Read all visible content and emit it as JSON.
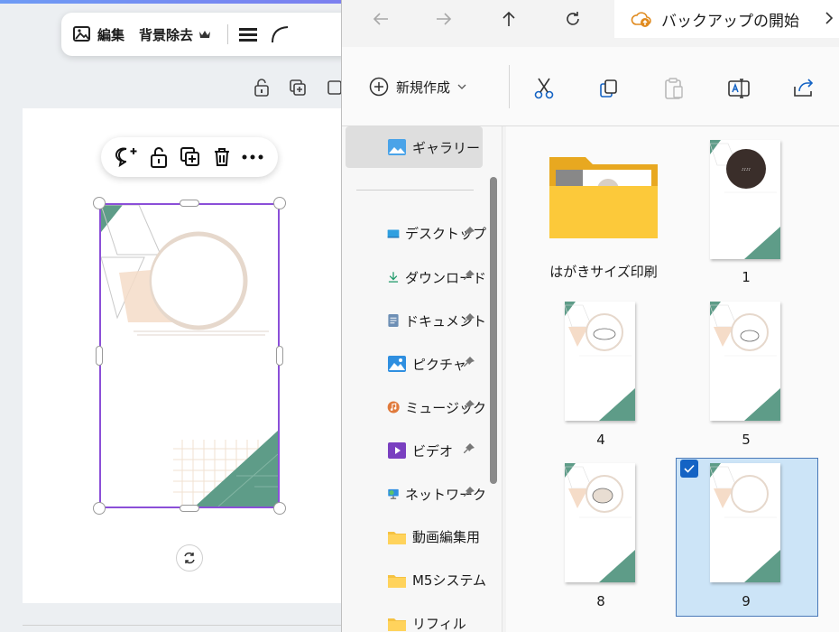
{
  "editor": {
    "toolbar": {
      "edit_label": "編集",
      "bg_remove_label": "背景除去"
    }
  },
  "explorer": {
    "backup_label": "バックアップの開始",
    "new_label": "新規作成",
    "sidebar": {
      "gallery": "ギャラリー",
      "items": [
        {
          "label": "デスクトップ",
          "pinned": true
        },
        {
          "label": "ダウンロード",
          "pinned": true
        },
        {
          "label": "ドキュメント",
          "pinned": true
        },
        {
          "label": "ピクチャ",
          "pinned": true
        },
        {
          "label": "ミュージック",
          "pinned": true
        },
        {
          "label": "ビデオ",
          "pinned": true
        },
        {
          "label": "ネットワーク",
          "pinned": true
        },
        {
          "label": "動画編集用",
          "pinned": false
        },
        {
          "label": "M5システム",
          "pinned": false
        },
        {
          "label": "リフィル",
          "pinned": false
        }
      ]
    },
    "files": [
      {
        "name": "はがきサイズ印刷",
        "type": "folder"
      },
      {
        "name": "1",
        "type": "image"
      },
      {
        "name": "4",
        "type": "image"
      },
      {
        "name": "5",
        "type": "image"
      },
      {
        "name": "8",
        "type": "image"
      },
      {
        "name": "9",
        "type": "image",
        "selected": true
      }
    ],
    "colors": {
      "accent": "#1463c4",
      "selection": "#cce4f7",
      "teal": "#5e9c88",
      "peach": "#f2d9c4"
    }
  }
}
